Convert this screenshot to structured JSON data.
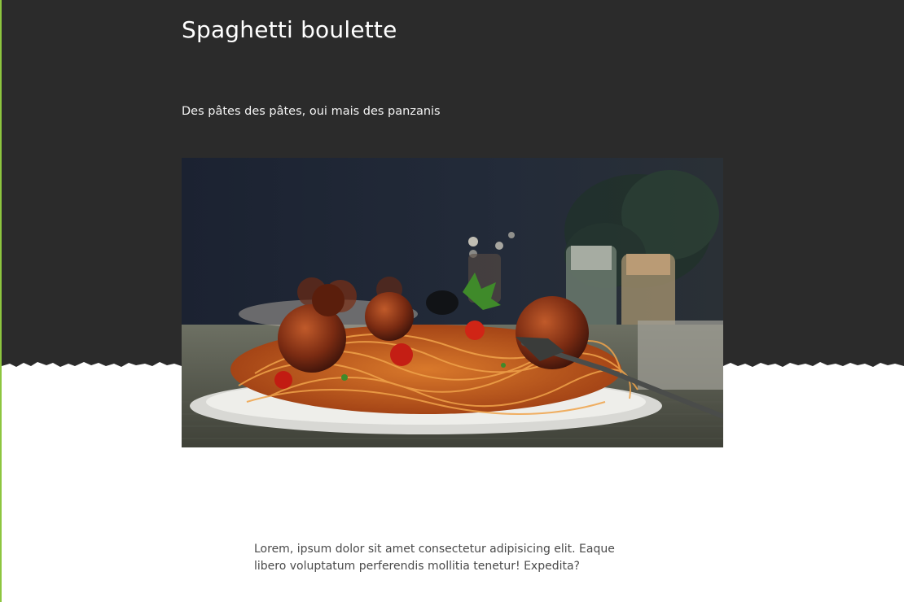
{
  "page": {
    "title": "Spaghetti boulette",
    "subtitle": "Des pâtes des pâtes, oui mais des panzanis",
    "body_text": "Lorem, ipsum dolor sit amet consectetur adipisicing elit. Eaque libero voluptatum perferendis mollitia tenetur! Expedita?"
  },
  "colors": {
    "hero_background": "#2b2b2b",
    "page_background": "#ffffff",
    "accent_line": "#8dc63f"
  },
  "image": {
    "subject": "plate-of-spaghetti-with-meatballs"
  }
}
